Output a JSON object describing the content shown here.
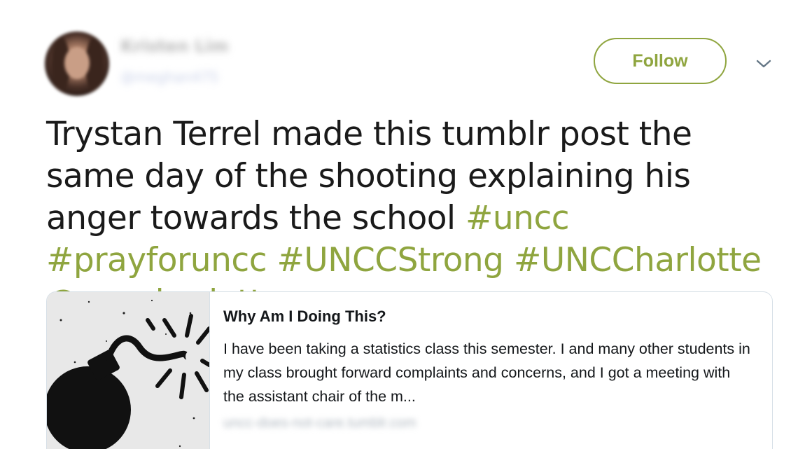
{
  "tweet": {
    "author_name": "Kristen Lim",
    "author_handle": "@meghan475",
    "follow_label": "Follow",
    "text_plain": "Trystan Terrel made this tumblr post the same day of the shooting explaining his anger towards the school ",
    "hashtags": [
      "#uncc",
      "#prayforuncc",
      "#UNCCStrong",
      "#UNCCharlotte"
    ],
    "mention": "@unccharlotte"
  },
  "card": {
    "title": "Why Am I Doing This?",
    "description": "I have been taking a statistics class this semester. I and many other students in my class brought forward complaints and concerns, and I got a meeting with the assistant chair of the m...",
    "domain": "uncc-does-not-care.tumblr.com",
    "image": "bomb-icon"
  },
  "colors": {
    "accent": "#8fa53f",
    "text": "#1a1a1a",
    "border": "#d7e0e7"
  },
  "icons": {
    "menu": "chevron-down-icon"
  }
}
